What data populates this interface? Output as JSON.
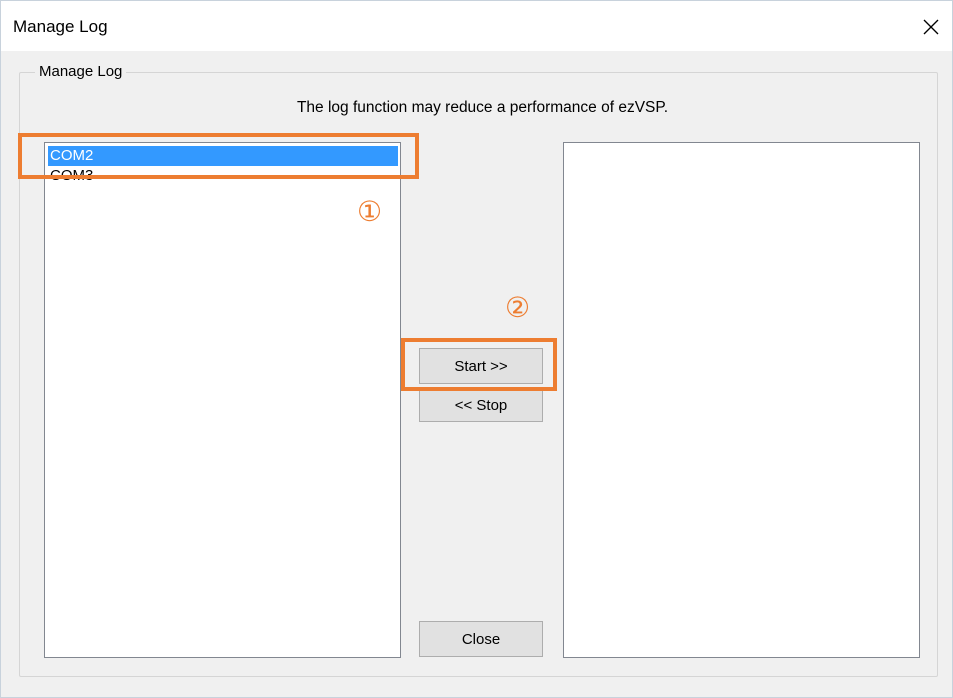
{
  "window": {
    "title": "Manage Log",
    "close_icon": "close-icon"
  },
  "group": {
    "label": "Manage Log",
    "notice": "The log function may reduce a performance of ezVSP."
  },
  "available_ports": {
    "items": [
      {
        "label": "COM2",
        "selected": true
      },
      {
        "label": "COM3",
        "selected": false
      }
    ]
  },
  "logging_ports": {
    "items": []
  },
  "buttons": {
    "start": "Start >>",
    "stop": "<< Stop",
    "close": "Close"
  },
  "annotations": {
    "marker_1": "①",
    "marker_2": "②",
    "highlight_color": "#ed7d31"
  },
  "colors": {
    "selection": "#3399ff"
  }
}
